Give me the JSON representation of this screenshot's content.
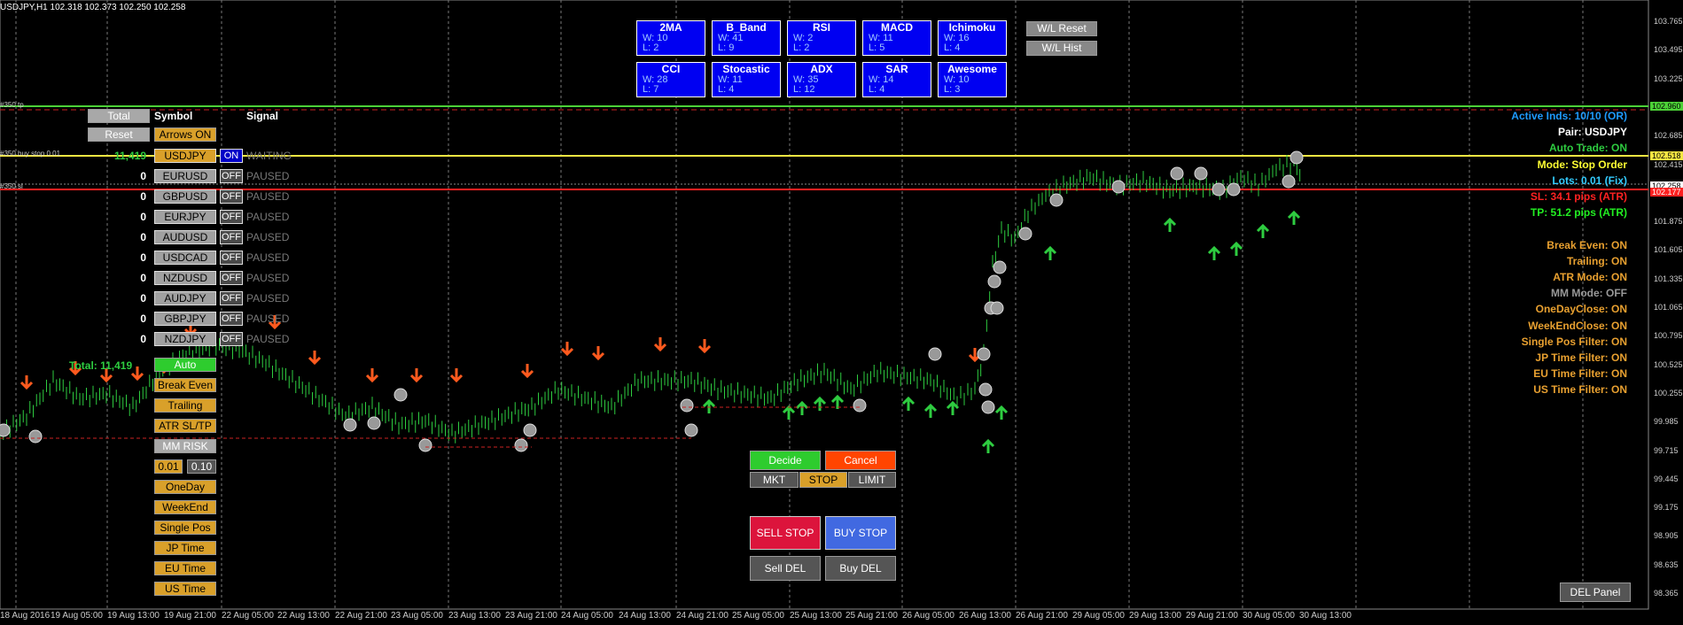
{
  "header": "USDJPY,H1  102.318 102.373 102.250 102.258",
  "indicators": [
    {
      "name": "2MA",
      "w": "W: 10",
      "l": "L: 2"
    },
    {
      "name": "B_Band",
      "w": "W: 41",
      "l": "L: 9"
    },
    {
      "name": "RSI",
      "w": "W: 2",
      "l": "L: 2"
    },
    {
      "name": "MACD",
      "w": "W: 11",
      "l": "L: 5"
    },
    {
      "name": "Ichimoku",
      "w": "W: 16",
      "l": "L: 4"
    },
    {
      "name": "CCI",
      "w": "W: 28",
      "l": "L: 7"
    },
    {
      "name": "Stocastic",
      "w": "W: 11",
      "l": "L: 4"
    },
    {
      "name": "ADX",
      "w": "W: 35",
      "l": "L: 12"
    },
    {
      "name": "SAR",
      "w": "W: 14",
      "l": "L: 4"
    },
    {
      "name": "Awesome",
      "w": "W: 10",
      "l": "L: 3"
    }
  ],
  "wl": {
    "reset": "W/L Reset",
    "hist": "W/L Hist"
  },
  "panel": {
    "total_btn": "Total",
    "reset_btn": "Reset",
    "symbol_header": "Symbol",
    "signal_header": "Signal",
    "arrows": "Arrows ON",
    "rows": [
      {
        "count": "11,419",
        "symbol": "USDJPY",
        "toggle": "ON",
        "signal": "WAITING"
      },
      {
        "count": "0",
        "symbol": "EURUSD",
        "toggle": "OFF",
        "signal": "PAUSED"
      },
      {
        "count": "0",
        "symbol": "GBPUSD",
        "toggle": "OFF",
        "signal": "PAUSED"
      },
      {
        "count": "0",
        "symbol": "EURJPY",
        "toggle": "OFF",
        "signal": "PAUSED"
      },
      {
        "count": "0",
        "symbol": "AUDUSD",
        "toggle": "OFF",
        "signal": "PAUSED"
      },
      {
        "count": "0",
        "symbol": "USDCAD",
        "toggle": "OFF",
        "signal": "PAUSED"
      },
      {
        "count": "0",
        "symbol": "NZDUSD",
        "toggle": "OFF",
        "signal": "PAUSED"
      },
      {
        "count": "0",
        "symbol": "AUDJPY",
        "toggle": "OFF",
        "signal": "PAUSED"
      },
      {
        "count": "0",
        "symbol": "GBPJPY",
        "toggle": "OFF",
        "signal": "PAUSED"
      },
      {
        "count": "0",
        "symbol": "NZDJPY",
        "toggle": "OFF",
        "signal": "PAUSED"
      }
    ],
    "total": "Total: 11,419",
    "auto": "Auto",
    "break_even": "Break Even",
    "trailing": "Trailing",
    "atr": "ATR SL/TP",
    "mm": "MM RISK",
    "lot1": "0.01",
    "lot2": "0.10",
    "oneday": "OneDay",
    "weekend": "WeekEnd",
    "single": "Single Pos",
    "jp": "JP Time",
    "eu": "EU Time",
    "us": "US Time"
  },
  "order": {
    "decide": "Decide",
    "cancel": "Cancel",
    "mkt": "MKT",
    "stop": "STOP",
    "limit": "LIMIT",
    "sell_stop": "SELL STOP",
    "buy_stop": "BUY STOP",
    "sell_del": "Sell DEL",
    "buy_del": "Buy DEL"
  },
  "del_panel": "DEL Panel",
  "info": [
    {
      "text": "Active Inds: 10/10 (OR)",
      "color": "#1e9bff"
    },
    {
      "text": "Pair: USDJPY",
      "color": "#ffffff"
    },
    {
      "text": "Auto Trade: ON",
      "color": "#2ecc40"
    },
    {
      "text": "Mode: Stop Order",
      "color": "#ffff33"
    },
    {
      "text": "Lots: 0.01 (Fix)",
      "color": "#33ccff"
    },
    {
      "text": "SL: 34.1 pips (ATR)",
      "color": "#ff2222"
    },
    {
      "text": "TP: 51.2 pips (ATR)",
      "color": "#22ee22"
    },
    {
      "text": "",
      "color": "#000"
    },
    {
      "text": "Break Even: ON",
      "color": "#e8a030"
    },
    {
      "text": "Trailing: ON",
      "color": "#e8a030"
    },
    {
      "text": "ATR Mode: ON",
      "color": "#e8a030"
    },
    {
      "text": "MM Mode: OFF",
      "color": "#999999"
    },
    {
      "text": "OneDayClose: ON",
      "color": "#e8a030"
    },
    {
      "text": "WeekEndClose: ON",
      "color": "#e8a030"
    },
    {
      "text": "Single Pos Filter: ON",
      "color": "#e8a030"
    },
    {
      "text": "JP Time Filter: ON",
      "color": "#e8a030"
    },
    {
      "text": "EU Time Filter: ON",
      "color": "#e8a030"
    },
    {
      "text": "US Time Filter: ON",
      "color": "#e8a030"
    }
  ],
  "line_labels": {
    "tp": "#350 tp",
    "buystop": "#350 buy stop 0.01",
    "sl": "#350 sl"
  },
  "price_axis": [
    "103.765",
    "103.495",
    "103.225",
    "102.955",
    "102.685",
    "102.415",
    "102.145",
    "101.875",
    "101.605",
    "101.335",
    "101.065",
    "100.795",
    "100.525",
    "100.255",
    "99.985",
    "99.715",
    "99.445",
    "99.175",
    "98.905",
    "98.635",
    "98.365"
  ],
  "price_tags": {
    "tp": "102.960",
    "buystop": "102.518",
    "current": "102.258",
    "sl": "102.177"
  },
  "time_axis": [
    "18 Aug 2016",
    "19 Aug 05:00",
    "19 Aug 13:00",
    "19 Aug 21:00",
    "22 Aug 05:00",
    "22 Aug 13:00",
    "22 Aug 21:00",
    "23 Aug 05:00",
    "23 Aug 13:00",
    "23 Aug 21:00",
    "24 Aug 05:00",
    "24 Aug 13:00",
    "24 Aug 21:00",
    "25 Aug 05:00",
    "25 Aug 13:00",
    "25 Aug 21:00",
    "26 Aug 05:00",
    "26 Aug 13:00",
    "26 Aug 21:00",
    "29 Aug 05:00",
    "29 Aug 13:00",
    "29 Aug 21:00",
    "30 Aug 05:00",
    "30 Aug 13:00"
  ],
  "colors": {
    "up": "#2ecc40",
    "down": "#ff5a1e",
    "tp_line": "#4cd137",
    "buy_line": "#f5e642",
    "sl_line": "#ff2020"
  }
}
